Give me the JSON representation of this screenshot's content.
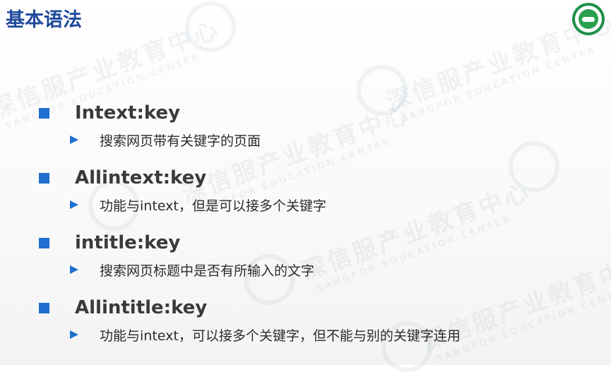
{
  "slide": {
    "title": "基本语法"
  },
  "watermark": {
    "cn": "深信服产业教育中心",
    "en": "SANGFOR EDUCATION CENTER"
  },
  "logo": {
    "icon": "sangfor-education-logo"
  },
  "colors": {
    "title": "#1f4a9c",
    "bullet": "#1e6fd0",
    "logo_green": "#1e8f4a"
  },
  "items": [
    {
      "title": "Intext:key",
      "desc": "搜索网页带有关键字的页面"
    },
    {
      "title": "Allintext:key",
      "desc": "功能与intext，但是可以接多个关键字"
    },
    {
      "title": "intitle:key",
      "desc": "搜索网页标题中是否有所输入的文字"
    },
    {
      "title": "Allintitle:key",
      "desc": "功能与intext，可以接多个关键字，但不能与别的关键字连用"
    }
  ]
}
